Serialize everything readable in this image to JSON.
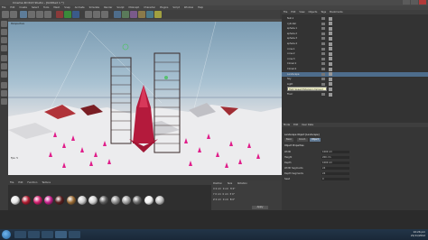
{
  "window": {
    "title": "Cinema 4D R13 Studio - [Untitled 1 *]"
  },
  "menu": {
    "items": [
      "File",
      "Edit",
      "Create",
      "Select",
      "Tools",
      "Mesh",
      "Snap",
      "Animate",
      "Simulate",
      "Render",
      "Sculpt",
      "MoGraph",
      "Character",
      "Plugins",
      "Script",
      "Window",
      "Help"
    ]
  },
  "viewport": {
    "label": "Perspective",
    "fps_label": "Fps: 5"
  },
  "object_manager": {
    "tabs": [
      "File",
      "Edit",
      "View",
      "Objects",
      "Tags",
      "Bookmarks"
    ],
    "rows": [
      {
        "name": "Null.1",
        "selected": false
      },
      {
        "name": "cylinder",
        "selected": false
      },
      {
        "name": "sphere.1",
        "selected": false
      },
      {
        "name": "sphere.2",
        "selected": false
      },
      {
        "name": "sphere.3",
        "selected": false
      },
      {
        "name": "sphere.4",
        "selected": false
      },
      {
        "name": "cone.1",
        "selected": false
      },
      {
        "name": "cone.2",
        "selected": false
      },
      {
        "name": "cone.3",
        "selected": false
      },
      {
        "name": "Cloner.1",
        "selected": false
      },
      {
        "name": "Cloner.2",
        "selected": false
      },
      {
        "name": "Landscape",
        "selected": true
      },
      {
        "name": "Sky",
        "selected": false
      },
      {
        "name": "Light",
        "selected": false
      },
      {
        "name": "Camera",
        "selected": false
      },
      {
        "name": "Floor",
        "selected": false
      }
    ],
    "tooltip": "High Speed Extension [Group]"
  },
  "attribute_manager": {
    "tabs": [
      "Mode",
      "Edit",
      "User Data"
    ],
    "object_label": "Landscape Object [Landscape]",
    "subtabs": [
      {
        "label": "Basic",
        "active": false
      },
      {
        "label": "Coord.",
        "active": false
      },
      {
        "label": "Object",
        "active": true
      }
    ],
    "section": "Object Properties",
    "fields": [
      {
        "label": "Width",
        "value": "1000 cm"
      },
      {
        "label": "Height",
        "value": "200 cm"
      },
      {
        "label": "Depth",
        "value": "1000 cm"
      },
      {
        "label": "Width Segments",
        "value": "24"
      },
      {
        "label": "Depth Segments",
        "value": "24"
      },
      {
        "label": "Seed",
        "value": "0"
      }
    ]
  },
  "material_manager": {
    "menu": [
      "File",
      "Edit",
      "Function",
      "Texture"
    ],
    "swatch_colors": [
      "#e6e6e6",
      "#b01a2f",
      "#d21c6c",
      "#c61e8a",
      "#5a1e1e",
      "#9a6b34",
      "#c8c8c8",
      "#d0d0d0",
      "#5c5c5c",
      "#8c8c8c",
      "#a0a0a0",
      "#6c6c6c",
      "#f0f0f0",
      "#bdbdbd"
    ]
  },
  "coordinates": {
    "headers": [
      "Position",
      "Size",
      "Rotation"
    ],
    "rows": [
      {
        "axis": "X",
        "pos": "0 cm",
        "size": "0 cm",
        "rot": "H 0°"
      },
      {
        "axis": "Y",
        "pos": "0 cm",
        "size": "0 cm",
        "rot": "P 0°"
      },
      {
        "axis": "Z",
        "pos": "0 cm",
        "size": "0 cm",
        "rot": "B 0°"
      }
    ],
    "apply_label": "Apply"
  },
  "taskbar": {
    "time": "10:26 pm",
    "date": "21/11/2012"
  },
  "colors": {
    "accent": "#4e6d8c",
    "magenta": "#e01d8a",
    "sky": "#9fbccd"
  }
}
